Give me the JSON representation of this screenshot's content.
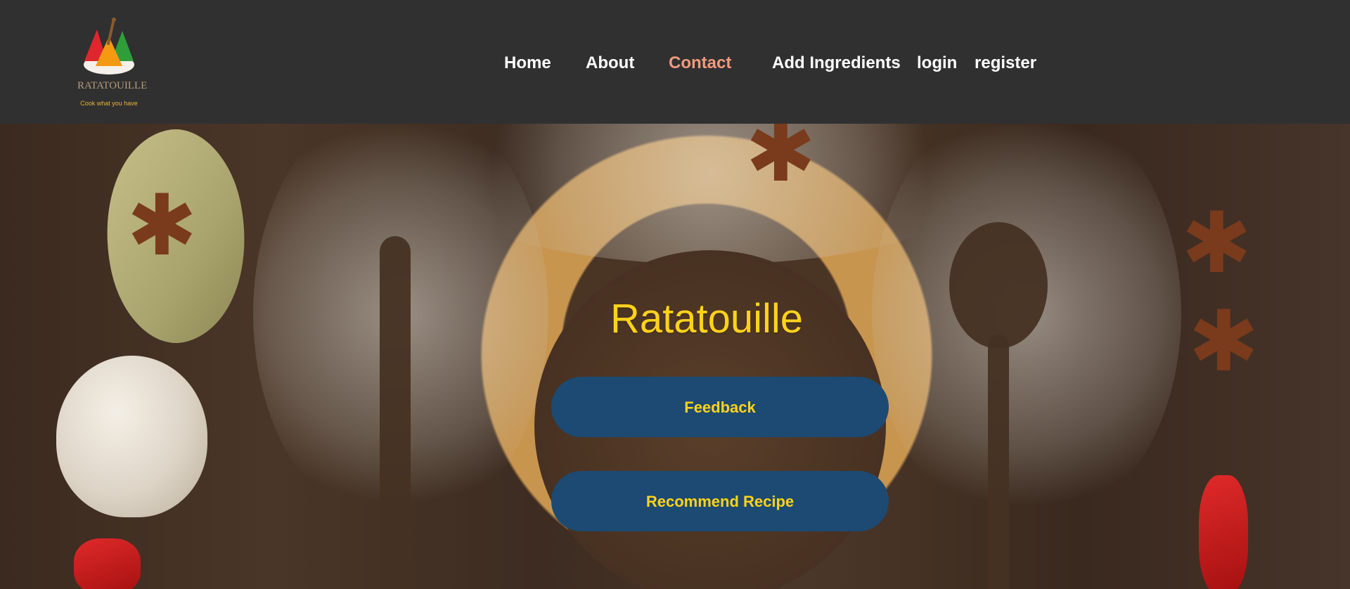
{
  "navbar": {
    "logo": {
      "name": "RATATOUILLE",
      "tagline": "Cook what you have"
    },
    "links": [
      {
        "label": "Home"
      },
      {
        "label": "About"
      },
      {
        "label": "Contact",
        "active": true
      },
      {
        "label": "Add Ingredients"
      },
      {
        "label": "login"
      },
      {
        "label": "register"
      }
    ],
    "active_color": "#f29a7e"
  },
  "hero": {
    "title": "Ratatouille",
    "buttons": [
      {
        "label": "Feedback"
      },
      {
        "label": "Recommend Recipe"
      }
    ],
    "title_color": "#ffd21a",
    "button_color": "#1c4a73"
  }
}
